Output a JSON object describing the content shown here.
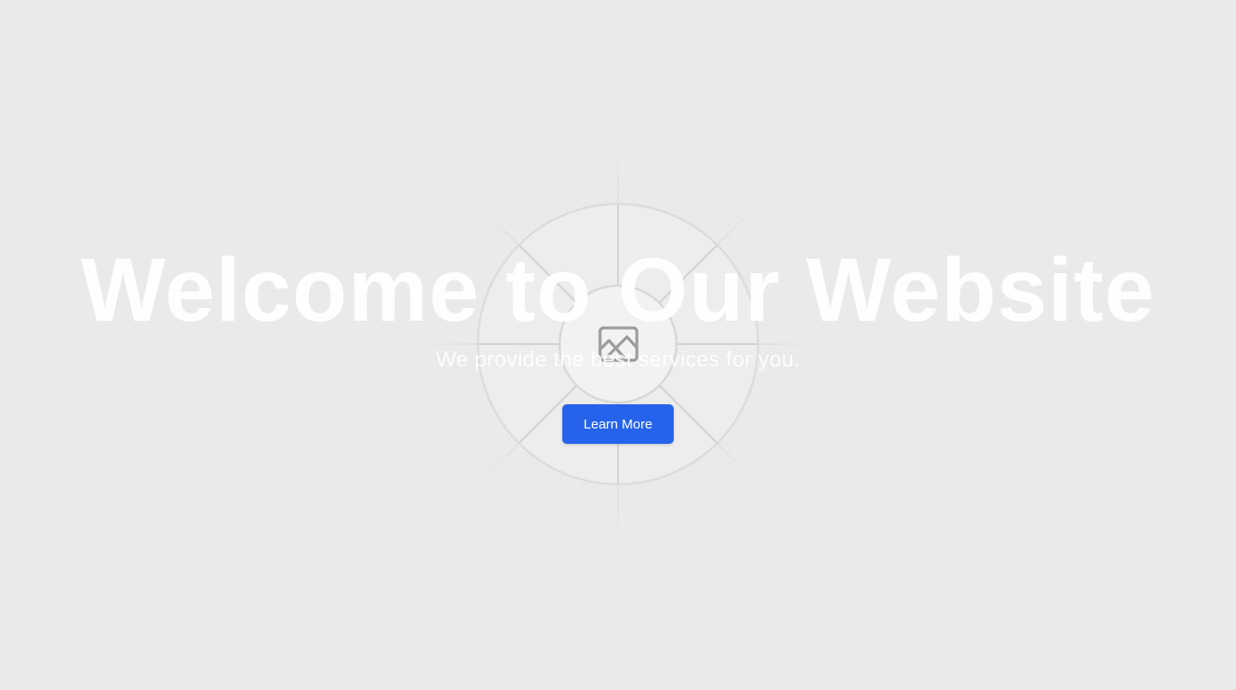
{
  "hero": {
    "title": "Welcome to Our Website",
    "subtitle": "We provide the best services for you.",
    "cta_label": "Learn More",
    "image_icon": "image-placeholder-icon"
  },
  "colors": {
    "background": "#eaeaea",
    "accent": "#2563eb",
    "title_text": "#ffffff",
    "button_text": "#ffffff",
    "placeholder_icon": "#9a9a9a"
  }
}
